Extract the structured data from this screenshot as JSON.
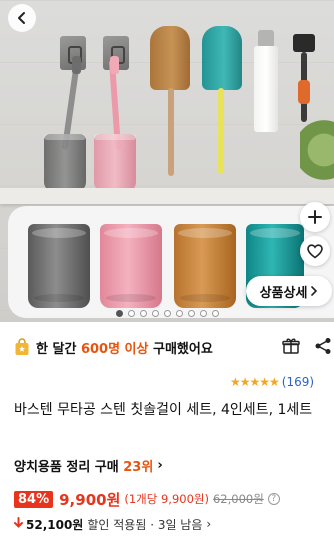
{
  "hero": {
    "image_alt": "바스텐 무타공 스텐 칫솔걸이 세트 상품 이미지",
    "detail_button_label": "상품상세",
    "carousel": {
      "total": 9,
      "active_index": 0
    }
  },
  "purchase_banner": {
    "prefix": "한 달간 ",
    "highlight": "600명 이상",
    "suffix": " 구매했어요"
  },
  "rating": {
    "stars": "★★★★★",
    "count": "(169)",
    "value": 5
  },
  "product": {
    "title": "바스텐 무타공 스텐 칫솔걸이 세트, 4인세트, 1세트"
  },
  "ranking": {
    "label": "양치용품 정리 구매 ",
    "rank": "23위",
    "chevron": "›"
  },
  "price": {
    "discount": "84%",
    "sale": "9,900원",
    "unit": "(1개당 9,900원)",
    "original": "62,000원",
    "info": "?"
  },
  "coupon": {
    "amount": "52,100원",
    "text": "할인 적용됨 · 3일 남음",
    "chevron": "›"
  },
  "colors": {
    "accent": "#e8540e",
    "price_red": "#e8341c",
    "star": "#f4a623",
    "link_blue": "#2a63c8"
  }
}
